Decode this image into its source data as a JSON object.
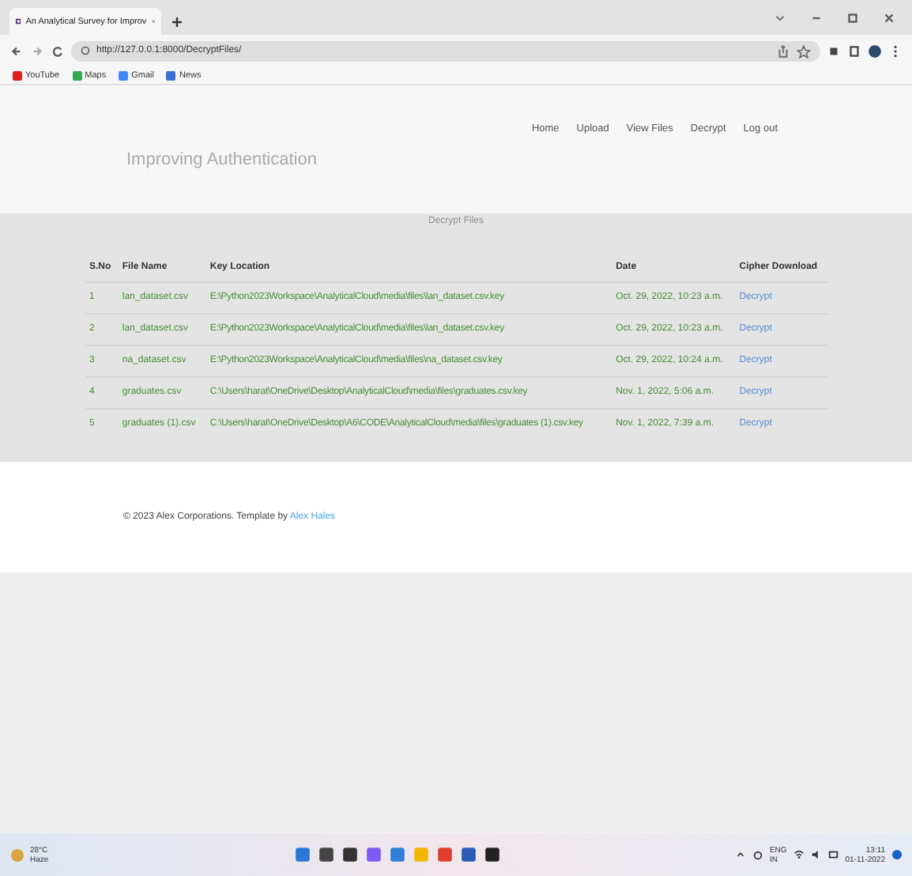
{
  "browser": {
    "tab_title": "An Analytical Survey for Improv",
    "url": "http://127.0.0.1:8000/DecryptFiles/",
    "bookmarks": [
      "YouTube",
      "Maps",
      "Gmail",
      "News"
    ]
  },
  "header": {
    "title": "Improving Authentication",
    "nav": [
      "Home",
      "Upload",
      "View Files",
      "Decrypt",
      "Log out"
    ],
    "subtitle": "Decrypt Files"
  },
  "table": {
    "columns": [
      "S.No",
      "File Name",
      "Key Location",
      "Date",
      "Cipher Download"
    ],
    "rows": [
      {
        "sno": "1",
        "file": "lan_dataset.csv",
        "key": "E:\\Python2023Workspace\\AnalyticalCloud\\media\\files\\lan_dataset.csv.key",
        "date": "Oct. 29, 2022, 10:23 a.m.",
        "action": "Decrypt"
      },
      {
        "sno": "2",
        "file": "lan_dataset.csv",
        "key": "E:\\Python2023Workspace\\AnalyticalCloud\\media\\files\\lan_dataset.csv.key",
        "date": "Oct. 29, 2022, 10:23 a.m.",
        "action": "Decrypt"
      },
      {
        "sno": "3",
        "file": "na_dataset.csv",
        "key": "E:\\Python2023Workspace\\AnalyticalCloud\\media\\files\\na_dataset.csv.key",
        "date": "Oct. 29, 2022, 10:24 a.m.",
        "action": "Decrypt"
      },
      {
        "sno": "4",
        "file": "graduates.csv",
        "key": "C:\\Users\\harat\\OneDrive\\Desktop\\AnalyticalCloud\\media\\files\\graduates.csv.key",
        "date": "Nov. 1, 2022, 5:06 a.m.",
        "action": "Decrypt"
      },
      {
        "sno": "5",
        "file": "graduates (1).csv",
        "key": "C:\\Users\\harat\\OneDrive\\Desktop\\A6\\CODE\\AnalyticalCloud\\media\\files\\graduates (1).csv.key",
        "date": "Nov. 1, 2022, 7:39 a.m.",
        "action": "Decrypt"
      }
    ]
  },
  "footer": {
    "text": "© 2023 Alex Corporations. Template by",
    "link": "Alex Hales"
  },
  "taskbar": {
    "temperature": "28°C",
    "weather": "Haze",
    "language": "ENG",
    "region": "IN",
    "time": "13:11",
    "date": "01-11-2022"
  }
}
